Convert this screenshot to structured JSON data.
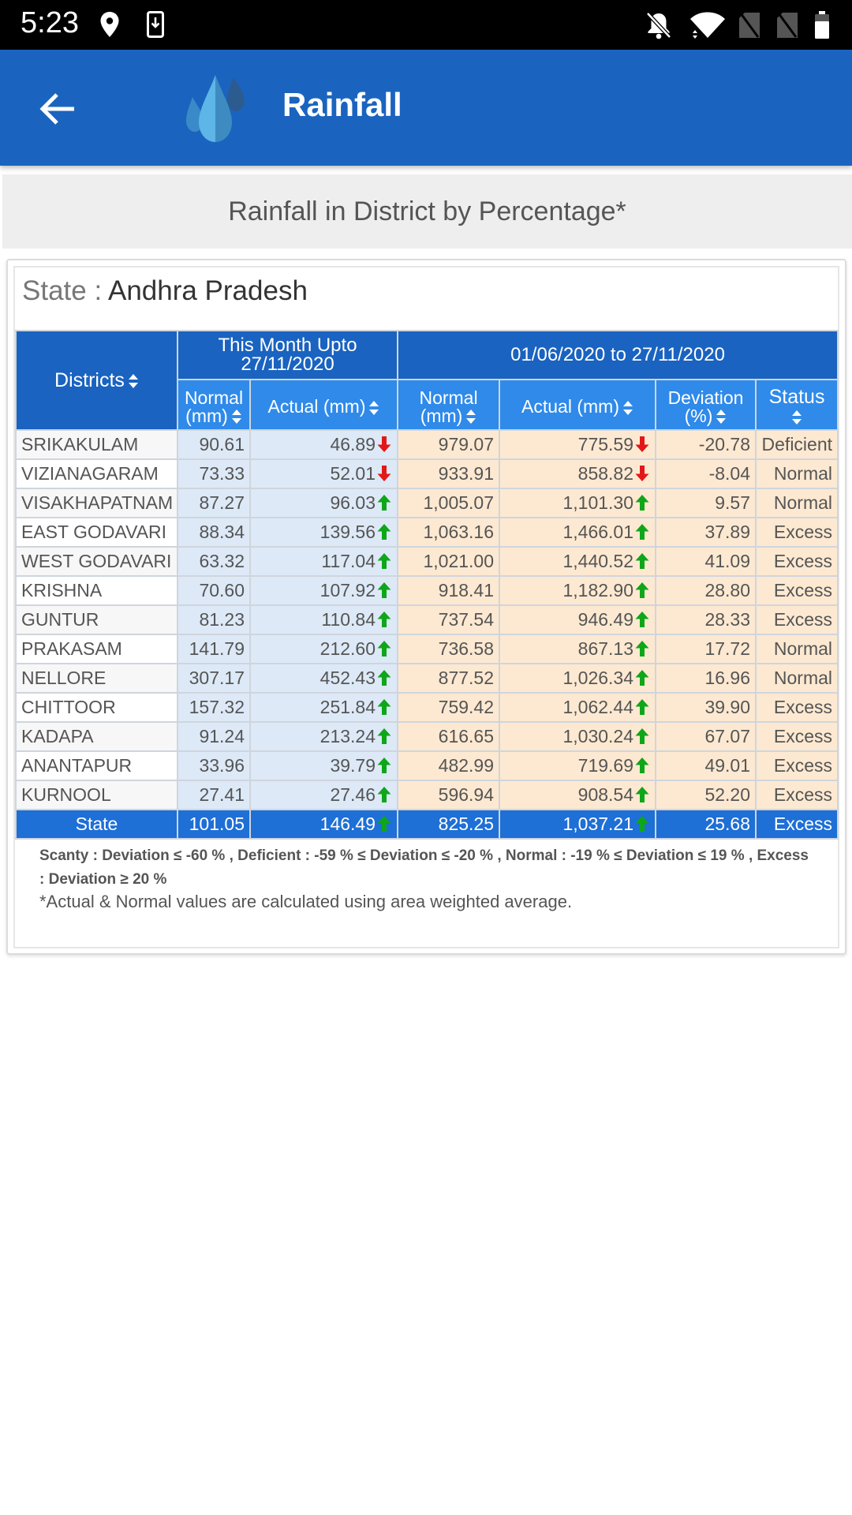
{
  "status_bar": {
    "time": "5:23",
    "icons": [
      "location-icon",
      "download-icon",
      "notifications-off-icon",
      "wifi-icon",
      "no-sim-icon",
      "no-sim-icon",
      "battery-icon"
    ]
  },
  "app_bar": {
    "back_icon": "arrow-back-icon",
    "logo_icon": "rain-drops-icon",
    "title": "Rainfall",
    "color": "#1a64bf"
  },
  "subtitle": "Rainfall in District by Percentage*",
  "state": {
    "label": "State : ",
    "value": "Andhra Pradesh"
  },
  "table": {
    "header": {
      "districts": "Districts",
      "month_group": "This Month Upto",
      "month_group_date": "27/11/2020",
      "season_group": "01/06/2020 to 27/11/2020",
      "normal": "Normal",
      "normal_unit": "(mm)",
      "actual": "Actual (mm)",
      "deviation": "Deviation",
      "deviation_unit": "(%)",
      "status": "Status"
    },
    "rows": [
      {
        "district": "SRIKAKULAM",
        "month_normal": "90.61",
        "month_actual": "46.89",
        "month_trend": "down",
        "season_normal": "979.07",
        "season_actual": "775.59",
        "season_trend": "down",
        "deviation": "-20.78",
        "status": "Deficient"
      },
      {
        "district": "VIZIANAGARAM",
        "month_normal": "73.33",
        "month_actual": "52.01",
        "month_trend": "down",
        "season_normal": "933.91",
        "season_actual": "858.82",
        "season_trend": "down",
        "deviation": "-8.04",
        "status": "Normal"
      },
      {
        "district": "VISAKHAPATNAM",
        "month_normal": "87.27",
        "month_actual": "96.03",
        "month_trend": "up",
        "season_normal": "1,005.07",
        "season_actual": "1,101.30",
        "season_trend": "up",
        "deviation": "9.57",
        "status": "Normal"
      },
      {
        "district": "EAST GODAVARI",
        "month_normal": "88.34",
        "month_actual": "139.56",
        "month_trend": "up",
        "season_normal": "1,063.16",
        "season_actual": "1,466.01",
        "season_trend": "up",
        "deviation": "37.89",
        "status": "Excess"
      },
      {
        "district": "WEST GODAVARI",
        "month_normal": "63.32",
        "month_actual": "117.04",
        "month_trend": "up",
        "season_normal": "1,021.00",
        "season_actual": "1,440.52",
        "season_trend": "up",
        "deviation": "41.09",
        "status": "Excess"
      },
      {
        "district": "KRISHNA",
        "month_normal": "70.60",
        "month_actual": "107.92",
        "month_trend": "up",
        "season_normal": "918.41",
        "season_actual": "1,182.90",
        "season_trend": "up",
        "deviation": "28.80",
        "status": "Excess"
      },
      {
        "district": "GUNTUR",
        "month_normal": "81.23",
        "month_actual": "110.84",
        "month_trend": "up",
        "season_normal": "737.54",
        "season_actual": "946.49",
        "season_trend": "up",
        "deviation": "28.33",
        "status": "Excess"
      },
      {
        "district": "PRAKASAM",
        "month_normal": "141.79",
        "month_actual": "212.60",
        "month_trend": "up",
        "season_normal": "736.58",
        "season_actual": "867.13",
        "season_trend": "up",
        "deviation": "17.72",
        "status": "Normal"
      },
      {
        "district": "NELLORE",
        "month_normal": "307.17",
        "month_actual": "452.43",
        "month_trend": "up",
        "season_normal": "877.52",
        "season_actual": "1,026.34",
        "season_trend": "up",
        "deviation": "16.96",
        "status": "Normal"
      },
      {
        "district": "CHITTOOR",
        "month_normal": "157.32",
        "month_actual": "251.84",
        "month_trend": "up",
        "season_normal": "759.42",
        "season_actual": "1,062.44",
        "season_trend": "up",
        "deviation": "39.90",
        "status": "Excess"
      },
      {
        "district": "KADAPA",
        "month_normal": "91.24",
        "month_actual": "213.24",
        "month_trend": "up",
        "season_normal": "616.65",
        "season_actual": "1,030.24",
        "season_trend": "up",
        "deviation": "67.07",
        "status": "Excess"
      },
      {
        "district": "ANANTAPUR",
        "month_normal": "33.96",
        "month_actual": "39.79",
        "month_trend": "up",
        "season_normal": "482.99",
        "season_actual": "719.69",
        "season_trend": "up",
        "deviation": "49.01",
        "status": "Excess"
      },
      {
        "district": "KURNOOL",
        "month_normal": "27.41",
        "month_actual": "27.46",
        "month_trend": "up",
        "season_normal": "596.94",
        "season_actual": "908.54",
        "season_trend": "up",
        "deviation": "52.20",
        "status": "Excess"
      }
    ],
    "total": {
      "district": "State",
      "month_normal": "101.05",
      "month_actual": "146.49",
      "month_trend": "up",
      "season_normal": "825.25",
      "season_actual": "1,037.21",
      "season_trend": "up",
      "deviation": "25.68",
      "status": "Excess"
    }
  },
  "legend": {
    "line1": "Scanty : Deviation ≤ -60 % ,    Deficient : -59 % ≤ Deviation ≤ -20 % ,    Normal : -19 % ≤ Deviation ≤ 19 % ,    Excess",
    "line2": ": Deviation ≥ 20 %"
  },
  "note": "*Actual & Normal values are calculated using area weighted average.",
  "colors": {
    "header_dark": "#1a63c0",
    "header_light": "#2f8ae9",
    "month_cell": "#dde9f7",
    "season_cell": "#fde9d1",
    "total_row": "#1e6fd6",
    "arrow_up": "#0fa61a",
    "arrow_down": "#e21818"
  }
}
